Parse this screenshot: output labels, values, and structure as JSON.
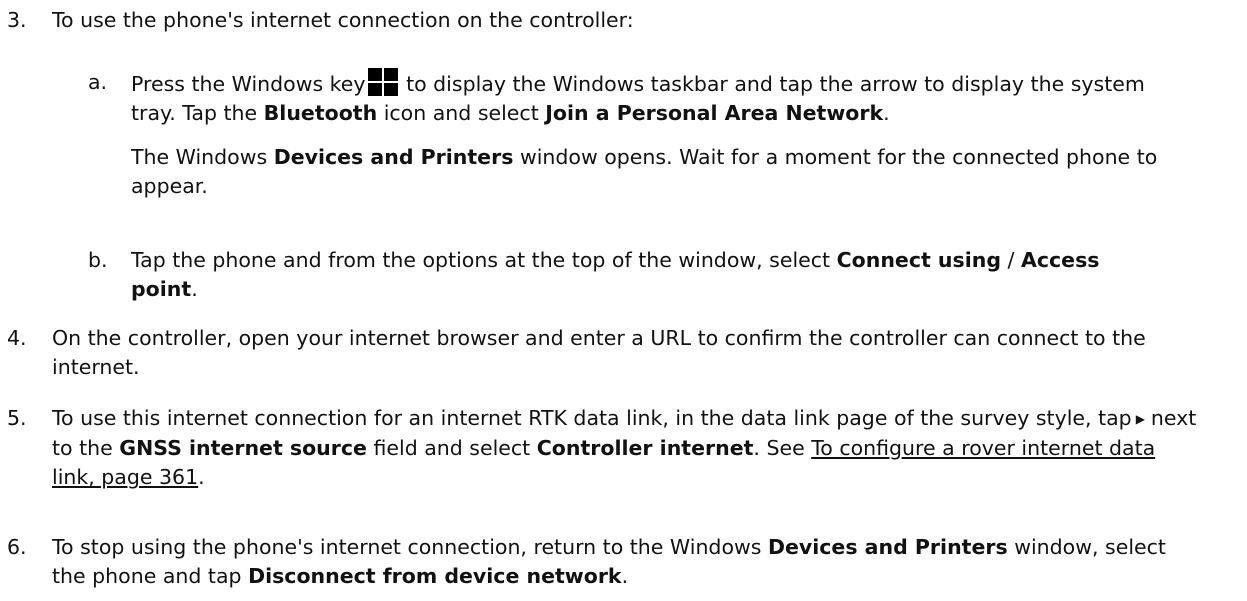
{
  "steps": {
    "s3": {
      "num": "3.",
      "text": "To use the phone's internet connection on the controller:",
      "a": {
        "letter": "a.",
        "p1_pre": "Press the Windows key",
        "p1_mid": "to display the Windows taskbar and tap the arrow to display the system tray. Tap the",
        "bluetooth": "Bluetooth",
        "p1_mid2": "icon and select",
        "join_pan": "Join a Personal Area Network",
        "p1_end": ".",
        "p2_pre": "The Windows",
        "devices_printers": "Devices and Printers",
        "p2_end": "window opens. Wait for a moment for the connected phone to appear."
      },
      "b": {
        "letter": "b.",
        "pre": "Tap the phone and from the options at the top of the window, select",
        "connect_using": "Connect using",
        "sep": "/",
        "access_point": "Access point",
        "end": "."
      }
    },
    "s4": {
      "num": "4.",
      "text": "On the controller, open your internet browser and enter a URL to confirm the controller can connect to the internet."
    },
    "s5": {
      "num": "5.",
      "pre": "To use this internet connection for an internet RTK data link, in the data link page of the survey style, tap",
      "tri": "▶",
      "mid": "next to the",
      "gnss_source": "GNSS internet source",
      "mid2": "field and select",
      "controller_internet": "Controller internet",
      "mid3": ". See",
      "link": "To configure a rover internet data link, page 361",
      "end": "."
    },
    "s6": {
      "num": "6.",
      "pre": "To stop using the phone's internet connection, return to the Windows",
      "devices_printers": "Devices and Printers",
      "mid": "window, select the phone and tap",
      "disconnect": "Disconnect from device network",
      "end": "."
    }
  },
  "icons": {
    "windows_key": "windows-logo-icon"
  }
}
